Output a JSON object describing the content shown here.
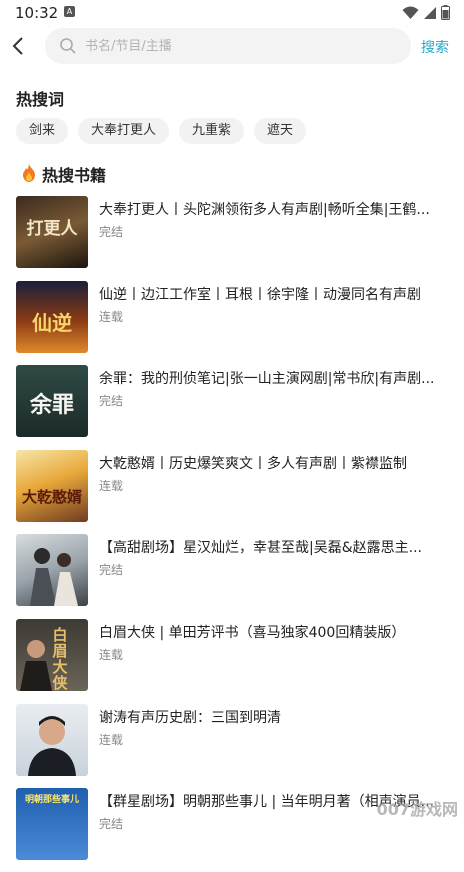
{
  "status_bar": {
    "time": "10:32"
  },
  "search": {
    "placeholder": "书名/节目/主播",
    "value": "",
    "action": "搜索"
  },
  "hot_words": {
    "title": "热搜词",
    "items": [
      "剑来",
      "大奉打更人",
      "九重紫",
      "遮天"
    ]
  },
  "hot_books": {
    "title": "热搜书籍",
    "items": [
      {
        "title": "大奉打更人丨头陀渊领衔多人有声剧|畅听全集|王鹤...",
        "status": "完结",
        "cover_text": "打更人"
      },
      {
        "title": "仙逆丨边江工作室丨耳根丨徐宇隆丨动漫同名有声剧",
        "status": "连载",
        "cover_text": "仙逆"
      },
      {
        "title": "余罪：我的刑侦笔记|张一山主演网剧|常书欣|有声剧...",
        "status": "完结",
        "cover_text": "余罪"
      },
      {
        "title": "大乾憨婿丨历史爆笑爽文丨多人有声剧丨紫襟监制",
        "status": "连载",
        "cover_text": "大乾憨婿"
      },
      {
        "title": "【高甜剧场】星汉灿烂，幸甚至哉|吴磊&赵露思主...",
        "status": "完结",
        "cover_text": ""
      },
      {
        "title": "白眉大侠 | 单田芳评书（喜马独家400回精装版）",
        "status": "连载",
        "cover_text": "白眉大侠"
      },
      {
        "title": "谢涛有声历史剧：三国到明清",
        "status": "连载",
        "cover_text": ""
      },
      {
        "title": "【群星剧场】明朝那些事儿 | 当年明月著（相声演员...",
        "status": "完结",
        "cover_text": "明朝那些事儿"
      }
    ]
  },
  "watermark": "007游戏网\nwww.yx007.com",
  "colors": {
    "accent": "#27a8c9",
    "chip_bg": "#f2f2f2",
    "search_bg": "#f3f3f3",
    "status_text": "#888888"
  }
}
